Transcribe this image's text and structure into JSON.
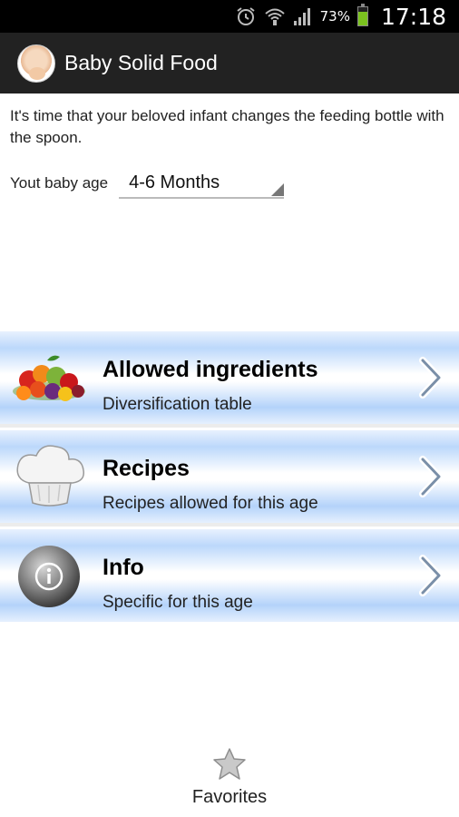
{
  "status_bar": {
    "battery_percent": "73%",
    "battery_level": 0.73,
    "time": "17:18",
    "icons": [
      "alarm-icon",
      "wifi-icon",
      "signal-icon",
      "battery-icon"
    ]
  },
  "action_bar": {
    "title": "Baby Solid Food",
    "logo_icon": "baby-avatar-icon"
  },
  "intro": {
    "text": "It's time that your beloved infant changes the feeding bottle with the spoon."
  },
  "age_selector": {
    "label": "Yout baby age",
    "selected": "4-6 Months"
  },
  "menu": [
    {
      "title": "Allowed ingredients",
      "subtitle": "Diversification table",
      "icon": "fruits-vegetables-icon"
    },
    {
      "title": "Recipes",
      "subtitle": "Recipes allowed for this age",
      "icon": "chef-hat-icon"
    },
    {
      "title": "Info",
      "subtitle": "Specific for this age",
      "icon": "info-icon"
    }
  ],
  "favorites": {
    "label": "Favorites",
    "icon": "star-icon"
  },
  "colors": {
    "status_bar": "#000000",
    "action_bar": "#222222",
    "row_blue": "#bcd8fb",
    "battery": "#7bc21f"
  }
}
